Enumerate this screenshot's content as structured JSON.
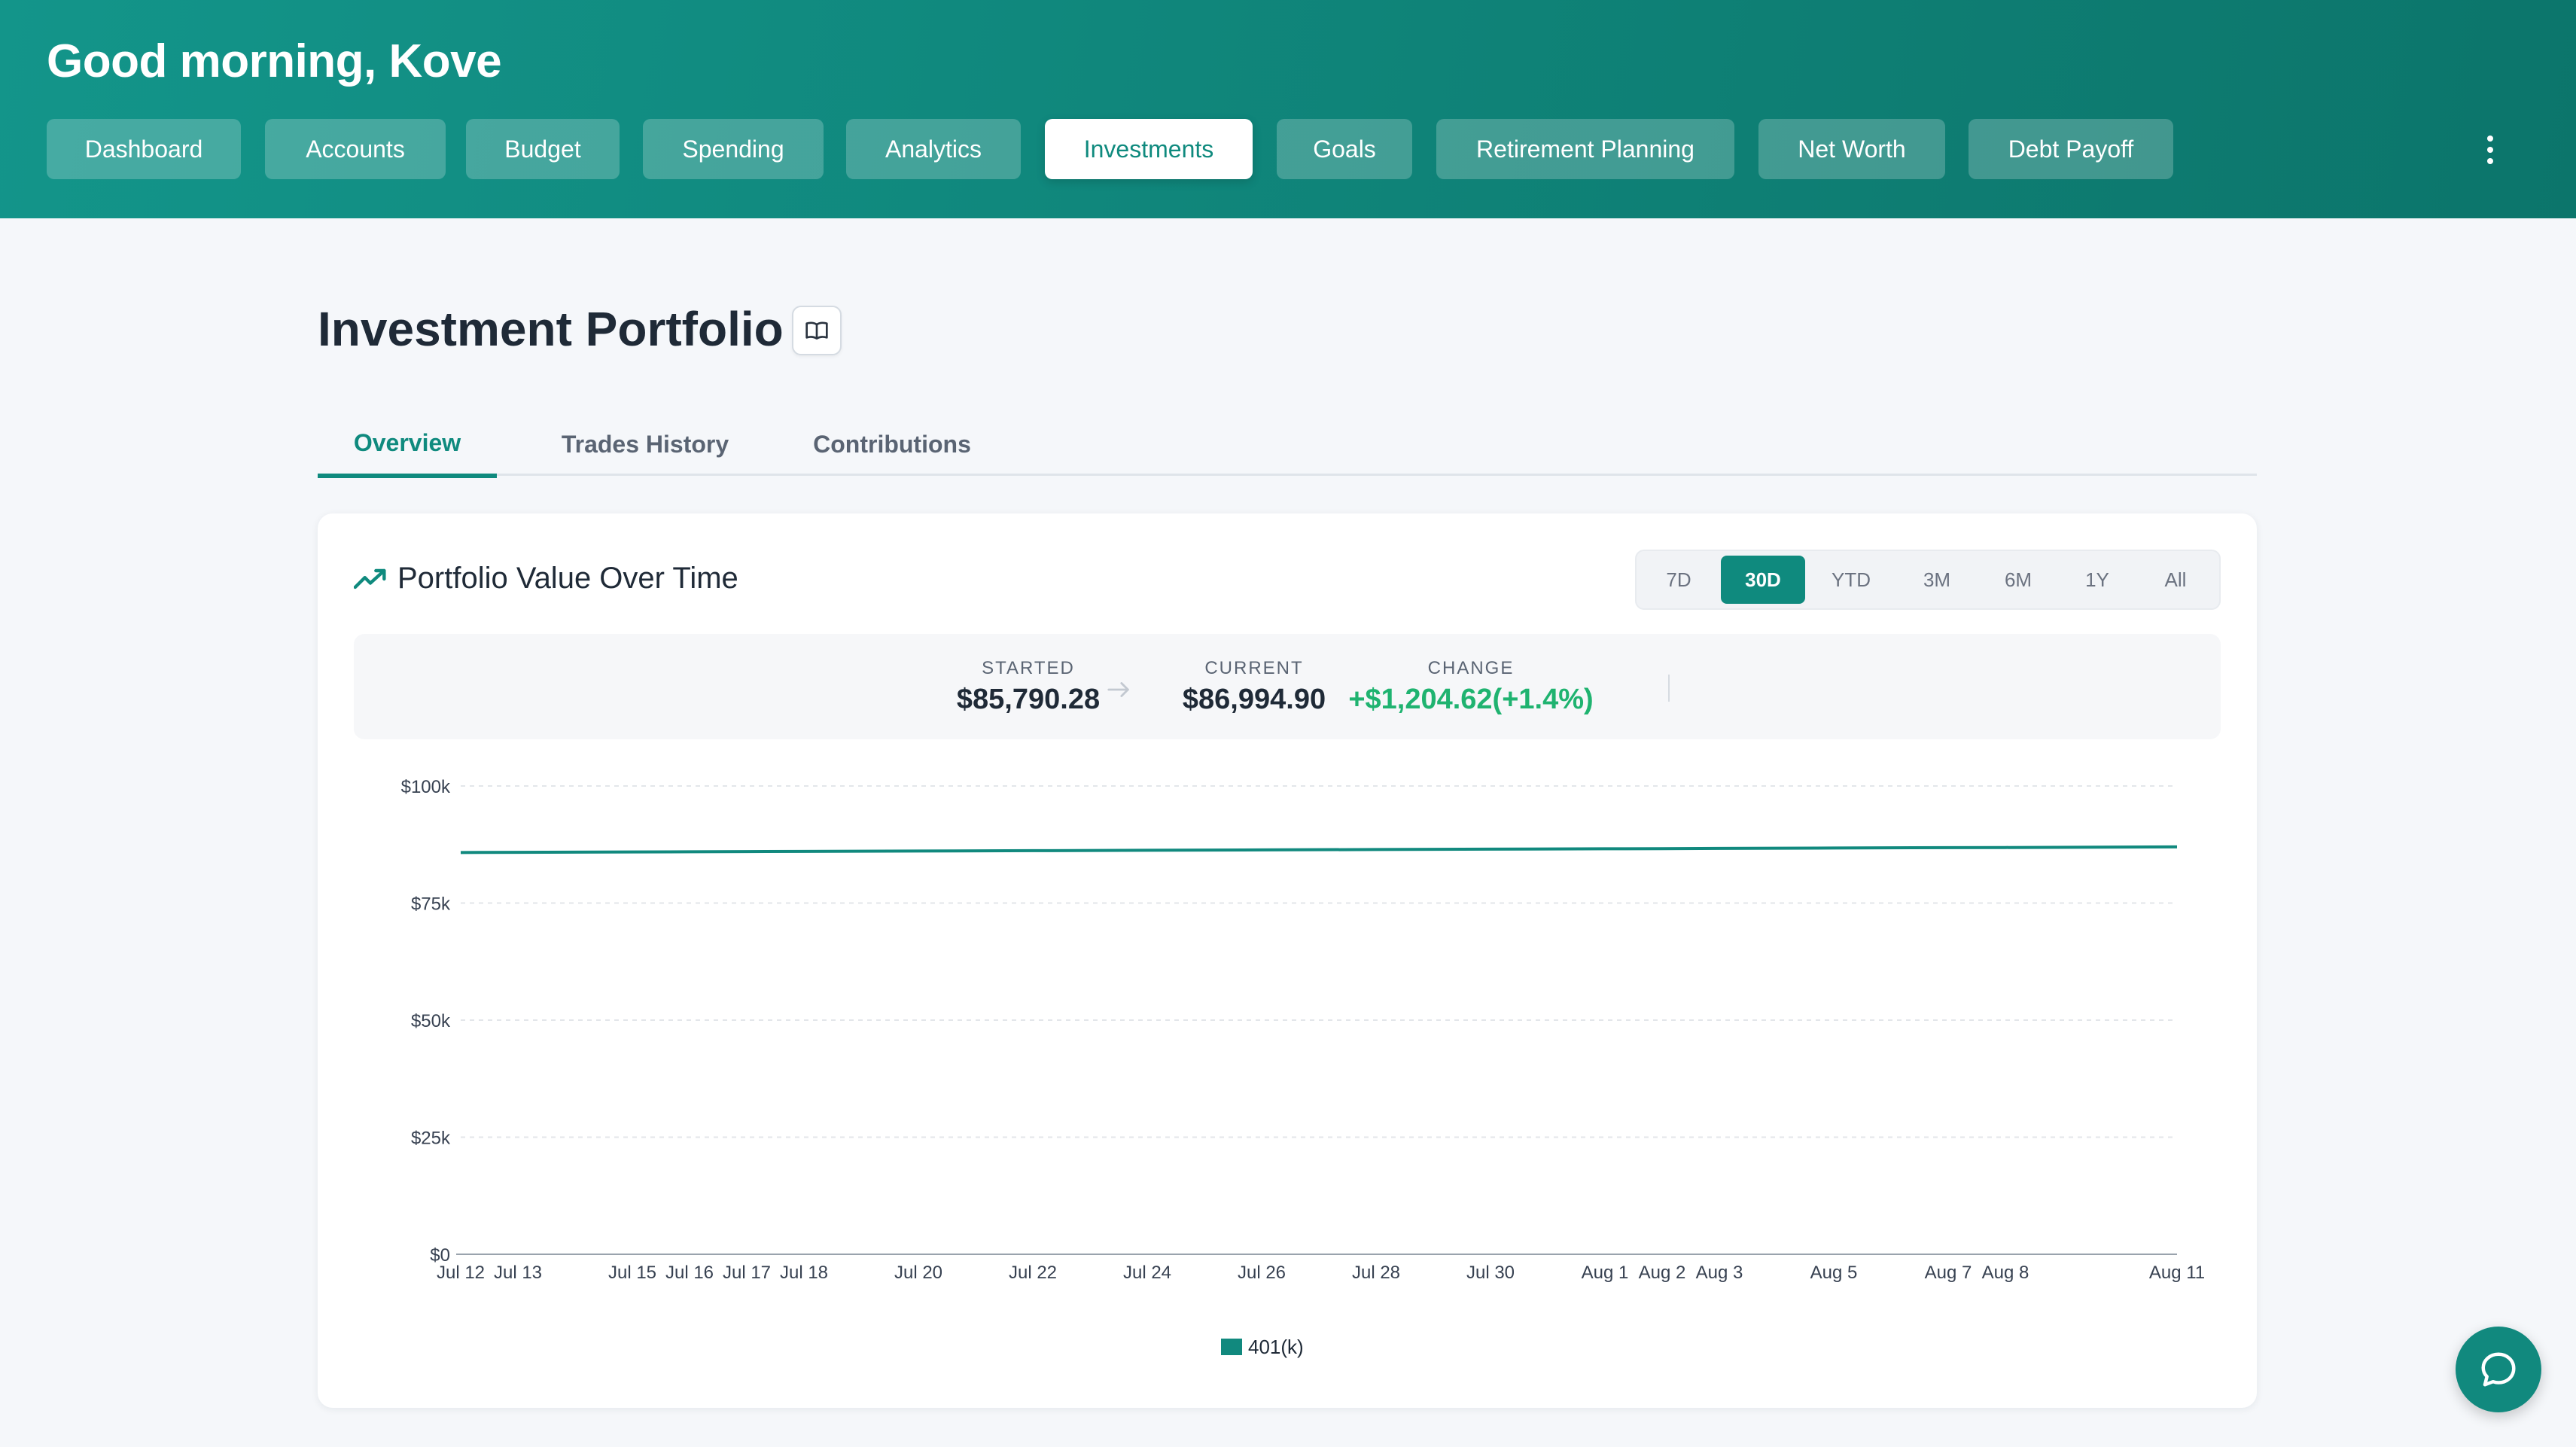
{
  "header": {
    "greeting": "Good morning, Kove",
    "nav": [
      {
        "label": "Dashboard",
        "active": false
      },
      {
        "label": "Accounts",
        "active": false
      },
      {
        "label": "Budget",
        "active": false
      },
      {
        "label": "Spending",
        "active": false
      },
      {
        "label": "Analytics",
        "active": false
      },
      {
        "label": "Investments",
        "active": true
      },
      {
        "label": "Goals",
        "active": false
      },
      {
        "label": "Retirement Planning",
        "active": false
      },
      {
        "label": "Net Worth",
        "active": false
      },
      {
        "label": "Debt Payoff",
        "active": false
      }
    ],
    "menu_icon": "kebab-menu-icon"
  },
  "page": {
    "title": "Investment Portfolio",
    "guide_icon": "book-icon",
    "tabs": [
      {
        "label": "Overview",
        "active": true
      },
      {
        "label": "Trades History",
        "active": false
      },
      {
        "label": "Contributions",
        "active": false
      }
    ]
  },
  "card": {
    "title": "Portfolio Value Over Time",
    "title_icon": "trending-up-icon",
    "ranges": [
      {
        "label": "7D",
        "active": false
      },
      {
        "label": "30D",
        "active": true
      },
      {
        "label": "YTD",
        "active": false
      },
      {
        "label": "3M",
        "active": false
      },
      {
        "label": "6M",
        "active": false
      },
      {
        "label": "1Y",
        "active": false
      },
      {
        "label": "All",
        "active": false
      }
    ],
    "stats": {
      "started_label": "STARTED",
      "started_value": "$85,790.28",
      "current_label": "CURRENT",
      "current_value": "$86,994.90",
      "change_label": "CHANGE",
      "change_value": "+$1,204.62(+1.4%)"
    }
  },
  "colors": {
    "brand": "#0f8a7e",
    "positive": "#1fb370",
    "line": "#11897e"
  },
  "chart_data": {
    "type": "line",
    "x": [
      "2024-07-12",
      "2024-07-13",
      "2024-07-15",
      "2024-07-16",
      "2024-07-17",
      "2024-07-18",
      "2024-07-20",
      "2024-07-22",
      "2024-07-24",
      "2024-07-26",
      "2024-07-28",
      "2024-07-30",
      "2024-08-01",
      "2024-08-02",
      "2024-08-03",
      "2024-08-05",
      "2024-08-07",
      "2024-08-08",
      "2024-08-11"
    ],
    "x_tick_labels": [
      "Jul 12",
      "Jul 13",
      "Jul 15",
      "Jul 16",
      "Jul 17",
      "Jul 18",
      "Jul 20",
      "Jul 22",
      "Jul 24",
      "Jul 26",
      "Jul 28",
      "Jul 30",
      "Aug 1",
      "Aug 2",
      "Aug 3",
      "Aug 5",
      "Aug 7",
      "Aug 8",
      "Aug 11"
    ],
    "series": [
      {
        "name": "401(k)",
        "color": "#11897e",
        "values": [
          85790,
          85830,
          85910,
          85950,
          85990,
          86030,
          86110,
          86190,
          86270,
          86350,
          86430,
          86510,
          86590,
          86630,
          86670,
          86750,
          86830,
          86870,
          86995
        ]
      }
    ],
    "y_ticks": [
      "$0",
      "$25k",
      "$50k",
      "$75k",
      "$100k"
    ],
    "ylim": [
      0,
      100000
    ],
    "grid": true,
    "legend": "bottom-center"
  }
}
